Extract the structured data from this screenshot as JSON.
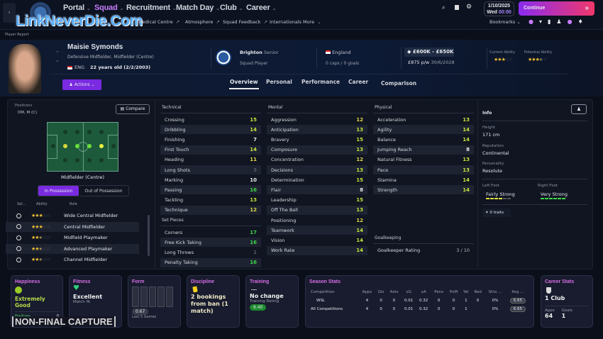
{
  "watermark": "LinkNeverDie.Com",
  "capture_label": "NON-FINAL CAPTURE",
  "nav": {
    "main": [
      {
        "label": "Portal",
        "active": false
      },
      {
        "label": "Squad",
        "active": true
      },
      {
        "label": "Recruitment",
        "active": false
      },
      {
        "label": "Match Day",
        "active": false
      },
      {
        "label": "Club",
        "active": false
      },
      {
        "label": "Career",
        "active": false
      }
    ],
    "sub": [
      "Medical Centre",
      "Atmosphere",
      "Squad Feedback",
      "Internationals",
      "More"
    ],
    "date": "1/10/2025",
    "day": "Wed",
    "time": "00:00",
    "continue_label": "Continue",
    "bookmarks_label": "Bookmarks",
    "accent": "#8b2cf0",
    "continue_gradient": [
      "#8b2cf0",
      "#f0386a"
    ]
  },
  "breadcrumb": "Player Report",
  "player": {
    "name": "Maisie Symonds",
    "positions_text": "Defensive Midfielder, Midfielder (Centre)",
    "nationality_code": "ENG",
    "age": "22 years old (2/2/2003)",
    "club": "Brighton",
    "club_team": "Senior",
    "squad_status": "Squad Player",
    "nation": "England",
    "caps": "0 caps / 0 goals",
    "value": "£600K - £650K",
    "wage": "£875 p/w",
    "contract_end": "30/6/2028",
    "current_ability_label": "Current Ability",
    "current_ability_stars": 3,
    "potential_ability_label": "Potential Ability",
    "potential_ability_stars": 3.5,
    "actions_label": "Actions"
  },
  "tabs": [
    "Overview",
    "Personal",
    "Performance",
    "Career",
    "Comparison"
  ],
  "active_tab": "Overview",
  "positions": {
    "label": "Positions",
    "value": "DM, M (C)",
    "compare_label": "Compare",
    "pitch_caption": "Midfielder (Centre)",
    "toggle": [
      "In Possession",
      "Out of Possession"
    ],
    "role_headers": [
      "Sel...",
      "Ability",
      "Role"
    ],
    "roles": [
      {
        "name": "Wide Central Midfielder",
        "stars": 3
      },
      {
        "name": "Central Midfielder",
        "stars": 3
      },
      {
        "name": "Midfield Playmaker",
        "stars": 2.5
      },
      {
        "name": "Advanced Playmaker",
        "stars": 2.5
      },
      {
        "name": "Channel Midfielder",
        "stars": 2.5
      }
    ]
  },
  "technical": {
    "label": "Technical",
    "items": [
      [
        "Crossing",
        15
      ],
      [
        "Dribbling",
        14
      ],
      [
        "Finishing",
        7
      ],
      [
        "First Touch",
        14
      ],
      [
        "Heading",
        11
      ],
      [
        "Long Shots",
        3
      ],
      [
        "Marking",
        10
      ],
      [
        "Passing",
        16
      ],
      [
        "Tackling",
        13
      ],
      [
        "Technique",
        12
      ]
    ]
  },
  "set_pieces": {
    "label": "Set Pieces",
    "items": [
      [
        "Corners",
        17
      ],
      [
        "Free Kick Taking",
        16
      ],
      [
        "Long Throws",
        1
      ],
      [
        "Penalty Taking",
        16
      ]
    ]
  },
  "mental": {
    "label": "Mental",
    "items": [
      [
        "Aggression",
        12
      ],
      [
        "Anticipation",
        13
      ],
      [
        "Bravery",
        15
      ],
      [
        "Composure",
        13
      ],
      [
        "Concentration",
        12
      ],
      [
        "Decisions",
        13
      ],
      [
        "Determination",
        15
      ],
      [
        "Flair",
        8
      ],
      [
        "Leadership",
        15
      ],
      [
        "Off The Ball",
        13
      ],
      [
        "Positioning",
        12
      ],
      [
        "Teamwork",
        14
      ],
      [
        "Vision",
        14
      ],
      [
        "Work Rate",
        14
      ]
    ]
  },
  "physical": {
    "label": "Physical",
    "items": [
      [
        "Acceleration",
        13
      ],
      [
        "Agility",
        14
      ],
      [
        "Balance",
        14
      ],
      [
        "Jumping Reach",
        8
      ],
      [
        "Natural Fitness",
        13
      ],
      [
        "Pace",
        13
      ],
      [
        "Stamina",
        14
      ],
      [
        "Strength",
        14
      ]
    ]
  },
  "goalkeeping": {
    "label": "Goalkeeping",
    "rating_label": "Goalkeeper Rating",
    "rating": "3 / 10"
  },
  "info": {
    "label": "Info",
    "height_label": "Height",
    "height": "171 cm",
    "reputation_label": "Reputation",
    "reputation": "Continental",
    "personality_label": "Personality",
    "personality": "Resolute",
    "left_foot_label": "Left Foot",
    "left_foot": "Fairly Strong",
    "left_foot_level": 4,
    "right_foot_label": "Right Foot",
    "right_foot": "Very Strong",
    "right_foot_level": 6,
    "traits": "0 traits"
  },
  "cards": {
    "happiness": {
      "title": "Happiness",
      "value": "Extremely Good",
      "sub": "Positives",
      "count": "0"
    },
    "fitness": {
      "title": "Fitness",
      "value": "Excellent",
      "sub": "Match fit"
    },
    "form": {
      "title": "Form",
      "rating": "0.67",
      "sub": "Last 5 Games"
    },
    "discipline": {
      "title": "Discipline",
      "value": "2 bookings from ban (1 match)"
    },
    "training": {
      "title": "Training",
      "value": "No change",
      "sub": "Training Rating",
      "rating": "6.40"
    },
    "season": {
      "title": "Season Stats",
      "headers": [
        "Competition",
        "Apps",
        "Gls",
        "Asts",
        "xG",
        "xA",
        "Pens",
        "PoM",
        "Yel",
        "Red",
        "Shts ...",
        "Avg ..."
      ],
      "rows": [
        [
          "WSL",
          "4",
          "0",
          "0",
          "0.01",
          "0.32",
          "0",
          "0",
          "1",
          "0",
          "0%",
          "6.65"
        ],
        [
          "All Competitions",
          "4",
          "0",
          "0",
          "0.01",
          "0.32",
          "0",
          "0",
          "1",
          "",
          "0%",
          "6.65"
        ]
      ]
    },
    "career": {
      "title": "Career Stats",
      "clubs": "1 Club",
      "apps_label": "Apps",
      "apps": "64",
      "goals_label": "Goals",
      "goals": "1"
    }
  }
}
